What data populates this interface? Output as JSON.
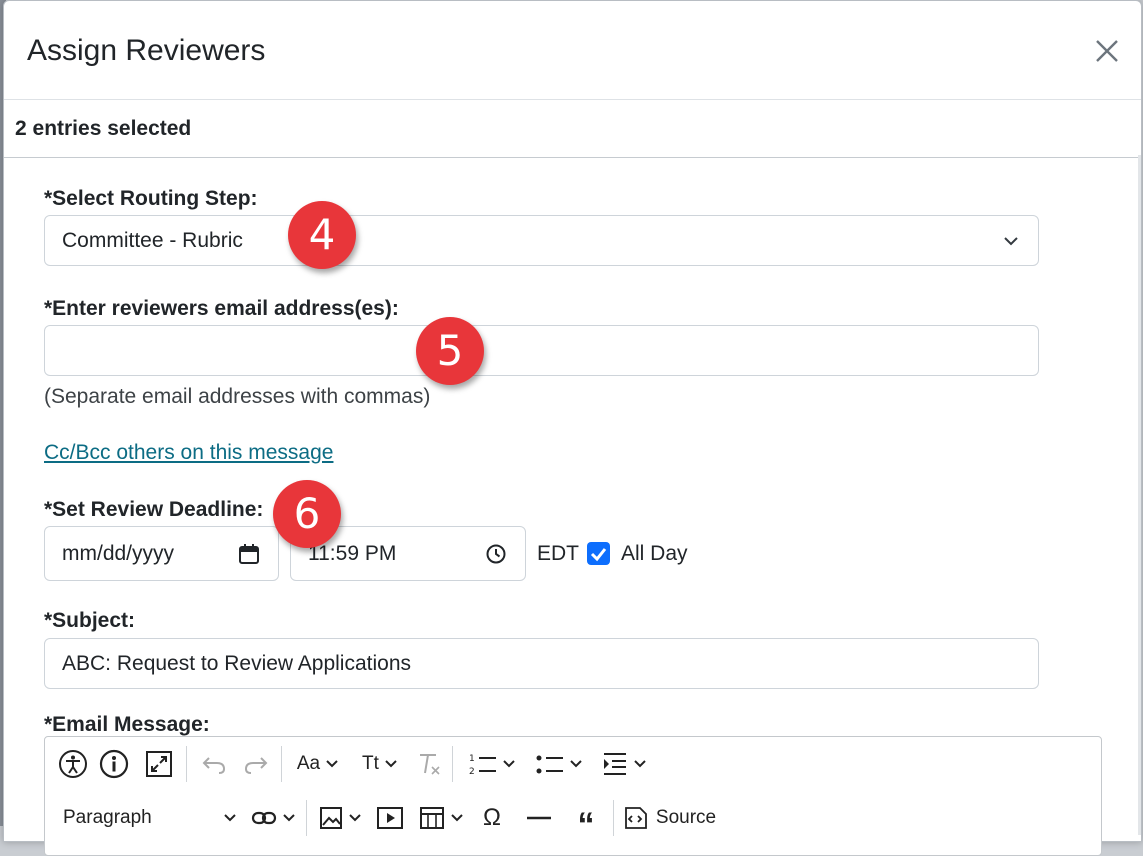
{
  "modal": {
    "title": "Assign Reviewers",
    "selection": "2 entries selected"
  },
  "form": {
    "routing_step_label": "*Select Routing Step:",
    "routing_step_value": "Committee - Rubric",
    "emails_label": "*Enter reviewers email address(es):",
    "emails_value": "",
    "emails_help": "(Separate email addresses with commas)",
    "cc_link": "Cc/Bcc others on this message",
    "deadline_label": "*Set Review Deadline:",
    "date_placeholder": "mm/dd/yyyy",
    "time_value": "11:59 PM",
    "timezone": "EDT",
    "all_day_label": "All Day",
    "all_day_checked": true,
    "subject_label": "*Subject:",
    "subject_value": "ABC: Request to Review Applications",
    "message_label": "*Email Message:"
  },
  "callouts": [
    "4",
    "5",
    "6"
  ],
  "editor_toolbar": {
    "paragraph_label": "Paragraph",
    "source_label": "Source",
    "font_size_label": "Aa",
    "text_case_label": "Tt",
    "icons": [
      "accessibility-icon",
      "info-icon",
      "fullscreen-icon",
      "undo-icon",
      "redo-icon",
      "font-size-icon",
      "text-case-icon",
      "remove-format-icon",
      "numbered-list-icon",
      "bulleted-list-icon",
      "indent-icon",
      "link-icon",
      "image-icon",
      "media-icon",
      "table-icon",
      "special-char-icon",
      "horizontal-line-icon",
      "blockquote-icon",
      "source-icon"
    ]
  },
  "colors": {
    "badge": "#e8363a",
    "link": "#0c6c84",
    "checkbox": "#0d6efd"
  }
}
